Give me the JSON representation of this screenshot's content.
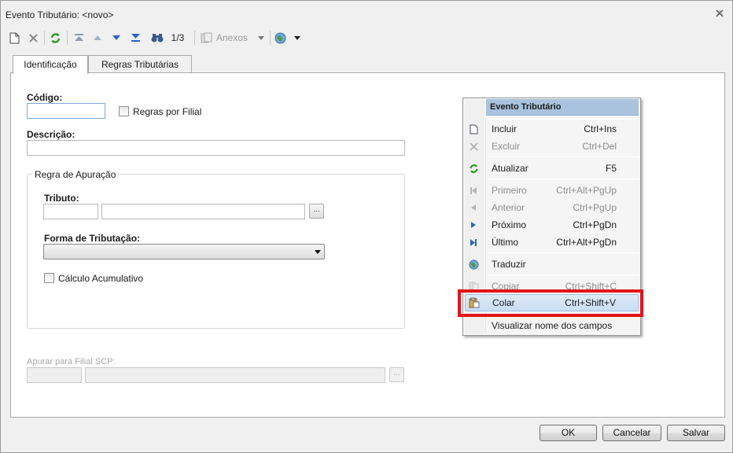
{
  "window": {
    "title": "Evento Tributário: <novo>"
  },
  "toolbar": {
    "record_counter": "1/3",
    "attachments_label": "Anexos"
  },
  "tabs": [
    {
      "label": "Identificação"
    },
    {
      "label": "Regras Tributárias"
    }
  ],
  "form": {
    "codigo_label": "Código:",
    "regras_filial_label": "Regras por Filial",
    "descricao_label": "Descrição:",
    "group_title": "Regra de Apuração",
    "tributo_label": "Tributo:",
    "lookup_button": "...",
    "forma_label": "Forma de Tributação:",
    "calculo_label": "Cálculo Acumulativo",
    "apurar_label": "Apurar para Filial SCP:"
  },
  "footer": {
    "ok": "OK",
    "cancel": "Cancelar",
    "save": "Salvar"
  },
  "context_menu": {
    "title": "Evento Tributário",
    "items": [
      {
        "label": "Incluir",
        "shortcut": "Ctrl+Ins"
      },
      {
        "label": "Excluir",
        "shortcut": "Ctrl+Del"
      },
      {
        "label": "Atualizar",
        "shortcut": "F5"
      },
      {
        "label": "Primeiro",
        "shortcut": "Ctrl+Alt+PgUp"
      },
      {
        "label": "Anterior",
        "shortcut": "Ctrl+PgUp"
      },
      {
        "label": "Próximo",
        "shortcut": "Ctrl+PgDn"
      },
      {
        "label": "Último",
        "shortcut": "Ctrl+Alt+PgDn"
      },
      {
        "label": "Traduzir",
        "shortcut": ""
      },
      {
        "label": "Copiar",
        "shortcut": "Ctrl+Shift+C"
      },
      {
        "label": "Colar",
        "shortcut": "Ctrl+Shift+V"
      },
      {
        "label": "Visualizar nome dos campos",
        "shortcut": ""
      }
    ]
  },
  "colors": {
    "menu_header": "#a9c3de",
    "highlight_border": "#e3151a",
    "refresh_green": "#2e9a2a",
    "nav_blue": "#2a66c9"
  }
}
